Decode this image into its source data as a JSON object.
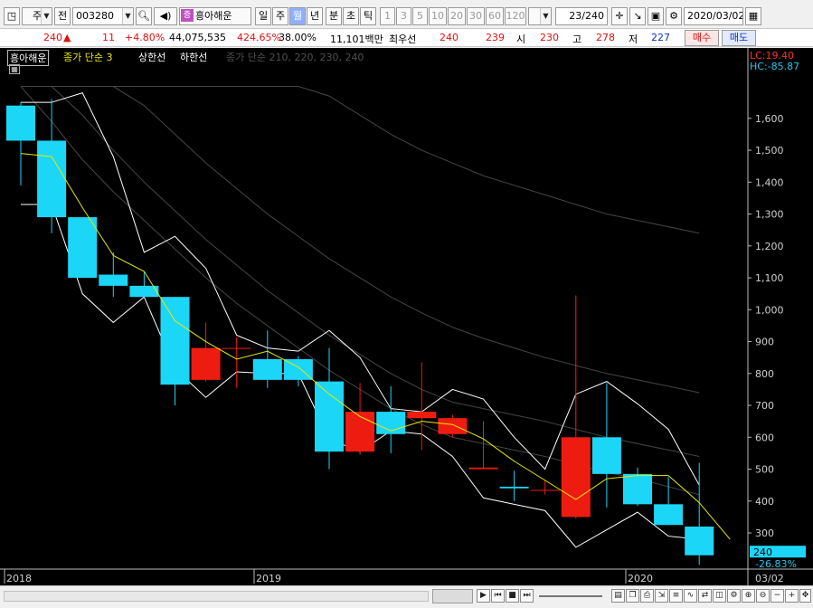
{
  "toolbar": {
    "period_label": "주",
    "period2_label": "전",
    "code": "003280",
    "stock_name": "흥아해운",
    "stock_badge": "증",
    "tabs": [
      "일",
      "주",
      "월",
      "년",
      "분",
      "초",
      "틱"
    ],
    "selected_tab": "월",
    "intervals": [
      "1",
      "3",
      "5",
      "10",
      "20",
      "30",
      "60",
      "120"
    ],
    "count": "23/240",
    "date": "2020/03/02"
  },
  "quote": {
    "price": "240",
    "change_arrow": "▲",
    "change": "11",
    "change_pct": "+4.80%",
    "volume": "44,075,535",
    "volume_ratio": "424.65%",
    "turnover": "38.00%",
    "amount": "11,101백만",
    "best_ask_label": "최우선",
    "best_ask": "240",
    "best_bid": "239",
    "open_label": "시",
    "open": "230",
    "high_label": "고",
    "high": "278",
    "low_label": "저",
    "low": "227",
    "buy_label": "매수",
    "sell_label": "매도"
  },
  "chart": {
    "name_tag": "흥아해운",
    "legend_ma": "종가 단순 3",
    "legend_upper": "상한선",
    "legend_lower": "하한선",
    "legend_ma_long": "종가 단순 210, 220, 230, 240",
    "lc_label": "LC:19.40",
    "hc_label": "HC:-85.87",
    "current_price_label": "240",
    "current_pct_label": "-26.83%",
    "date_labels": [
      "2018",
      "2019",
      "2020",
      "03/02"
    ],
    "colors": {
      "up": "#ee1c10",
      "down": "#1cd6f8",
      "ma": "#e8e800",
      "band": "#ffffff",
      "long_ma": "#464646",
      "grid": "#3a3a3a"
    }
  },
  "chart_data": {
    "type": "candlestick",
    "period": "monthly",
    "x": [
      "2018-01",
      "2018-02",
      "2018-03",
      "2018-04",
      "2018-05",
      "2018-06",
      "2018-07",
      "2018-08",
      "2018-09",
      "2018-10",
      "2018-11",
      "2018-12",
      "2019-01",
      "2019-02",
      "2019-03",
      "2019-04",
      "2019-05",
      "2019-06",
      "2019-07",
      "2019-08",
      "2019-09",
      "2019-10",
      "2019-11"
    ],
    "open": [
      1640,
      1530,
      1290,
      1110,
      1075,
      1040,
      780,
      880,
      845,
      845,
      775,
      555,
      680,
      660,
      610,
      500,
      445,
      435,
      350,
      600,
      485,
      390,
      320
    ],
    "high": [
      1650,
      1660,
      1290,
      1180,
      1120,
      1040,
      960,
      915,
      935,
      855,
      880,
      770,
      760,
      835,
      670,
      650,
      495,
      465,
      1045,
      770,
      505,
      475,
      520
    ],
    "low": [
      1390,
      1240,
      1100,
      1040,
      1040,
      700,
      775,
      755,
      755,
      760,
      500,
      545,
      550,
      560,
      600,
      500,
      400,
      420,
      345,
      380,
      385,
      325,
      200
    ],
    "close": [
      1530,
      1290,
      1100,
      1075,
      1040,
      765,
      880,
      880,
      780,
      780,
      555,
      680,
      610,
      680,
      660,
      505,
      440,
      435,
      600,
      485,
      390,
      325,
      230
    ],
    "ma3": [
      1490,
      1480,
      1320,
      1170,
      1120,
      965,
      900,
      845,
      870,
      820,
      735,
      665,
      620,
      650,
      640,
      595,
      525,
      465,
      405,
      470,
      480,
      480,
      395,
      280
    ],
    "upper": [
      1650,
      1650,
      1680,
      1480,
      1180,
      1230,
      1130,
      920,
      880,
      870,
      935,
      850,
      690,
      680,
      750,
      720,
      600,
      500,
      735,
      775,
      705,
      625,
      450
    ],
    "lower": [
      1330,
      1330,
      1050,
      960,
      1040,
      815,
      725,
      805,
      800,
      800,
      595,
      555,
      620,
      610,
      540,
      410,
      390,
      370,
      255,
      310,
      365,
      290,
      280
    ],
    "long_ma": [
      [
        1700,
        1590,
        1470,
        1370,
        1280,
        1190,
        1100,
        1020,
        950,
        880,
        810,
        750,
        690,
        640,
        600,
        580,
        560,
        540,
        515,
        490,
        470,
        445,
        420
      ],
      [
        1700,
        1700,
        1610,
        1500,
        1400,
        1310,
        1220,
        1140,
        1060,
        990,
        920,
        860,
        800,
        750,
        710,
        690,
        670,
        650,
        625,
        600,
        580,
        560,
        540
      ],
      [
        1700,
        1700,
        1700,
        1700,
        1640,
        1550,
        1460,
        1380,
        1300,
        1230,
        1160,
        1100,
        1040,
        990,
        945,
        910,
        880,
        850,
        825,
        800,
        780,
        760,
        740
      ],
      [
        1700,
        1700,
        1700,
        1700,
        1700,
        1700,
        1700,
        1700,
        1700,
        1700,
        1670,
        1610,
        1550,
        1500,
        1460,
        1420,
        1390,
        1360,
        1330,
        1300,
        1280,
        1260,
        1240
      ]
    ],
    "yticks": [
      300,
      400,
      500,
      600,
      700,
      800,
      900,
      1000,
      1100,
      1200,
      1300,
      1400,
      1500,
      1600
    ],
    "ylim": [
      195,
      1705
    ]
  }
}
